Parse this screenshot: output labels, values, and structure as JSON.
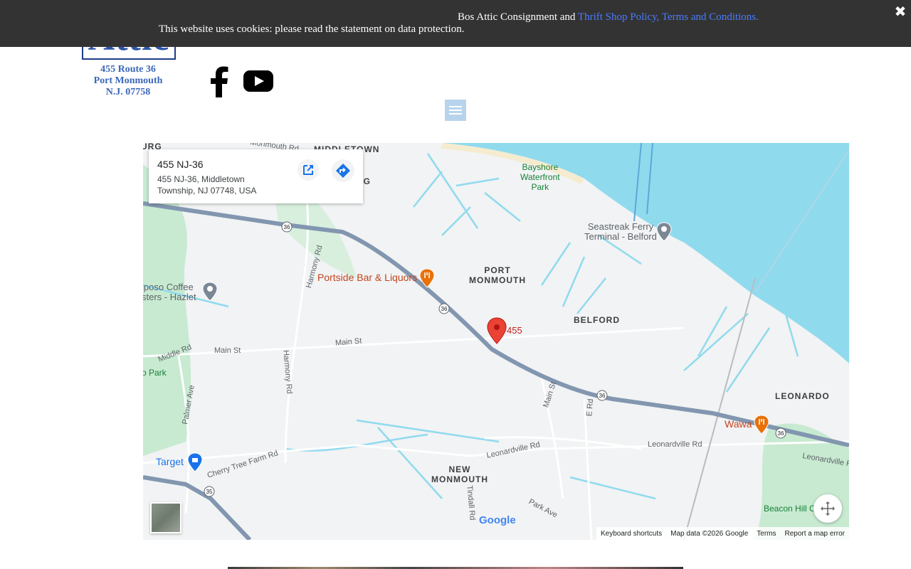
{
  "cookie_bar": {
    "line1_text": "Bos Attic Consignment and ",
    "line1_link": "Thrift Shop Policy, Terms and Conditions.",
    "line2_text": "This website uses cookies: please read the statement on data protection.",
    "close_icon": "close-icon"
  },
  "logo": {
    "name": "Attic",
    "address_line1": "455 Route 36",
    "address_line2": "Port Monmouth",
    "address_line3": "N.J. 07758"
  },
  "social": {
    "facebook_icon": "facebook-icon",
    "youtube_icon": "youtube-icon"
  },
  "menu": {
    "icon": "hamburger-menu-icon"
  },
  "map": {
    "info_card": {
      "title": "455 NJ-36",
      "address_line1": "455 NJ-36, Middletown",
      "address_line2": "Township, NJ 07748, USA"
    },
    "pin_label": "455",
    "areas": {
      "middletown": "MIDDLETOWN",
      "port_monmouth_1": "PORT",
      "port_monmouth_2": "MONMOUTH",
      "belford": "BELFORD",
      "leonardo": "LEONARDO",
      "new_monmouth_1": "NEW",
      "new_monmouth_2": "MONMOUTH",
      "rg_left": "URG",
      "rg_card": "RG"
    },
    "parks": {
      "bayshore_1": "Bayshore",
      "bayshore_2": "Waterfront",
      "bayshore_3": "Park",
      "lo_park": "o Park",
      "beacon_hill": "Beacon Hill Country"
    },
    "pois": {
      "seastreak_1": "Seastreak Ferry",
      "seastreak_2": "Terminal - Belford",
      "mariposo_1": "iposo Coffee",
      "mariposo_2": "sters - Hazlet",
      "portside": "Portside Bar & Liquors",
      "wawa": "Wawa",
      "target": "Target"
    },
    "roads": {
      "monmouth_rd": "Monmouth Rd",
      "harmony_rd_1": "Harmony Rd",
      "harmony_rd_2": "Harmony Rd",
      "main_st_1": "Main St",
      "main_st_2": "Main St",
      "main_st_3": "Main St",
      "middle_rd": "Middle Rd",
      "palmer_ave": "Palmer Ave",
      "e_rd": "E Rd",
      "leonardville_1": "Leonardville Rd",
      "leonardville_2": "Leonardville Rd",
      "leonardville_3": "Leonardville R",
      "cherry_tree": "Cherry Tree Farm Rd",
      "tindall": "Tindall Rd",
      "park_ave": "Park Ave"
    },
    "route_shields": [
      "36",
      "36",
      "36",
      "36",
      "35"
    ],
    "google_logo": "Google",
    "footer": {
      "keyboard": "Keyboard shortcuts",
      "map_data": "Map data ©2026 Google",
      "terms": "Terms",
      "report": "Report a map error"
    },
    "colors": {
      "water": "#90daee",
      "highway": "#8296b0",
      "park": "#c7ead1",
      "pin": "#ea4335"
    }
  }
}
